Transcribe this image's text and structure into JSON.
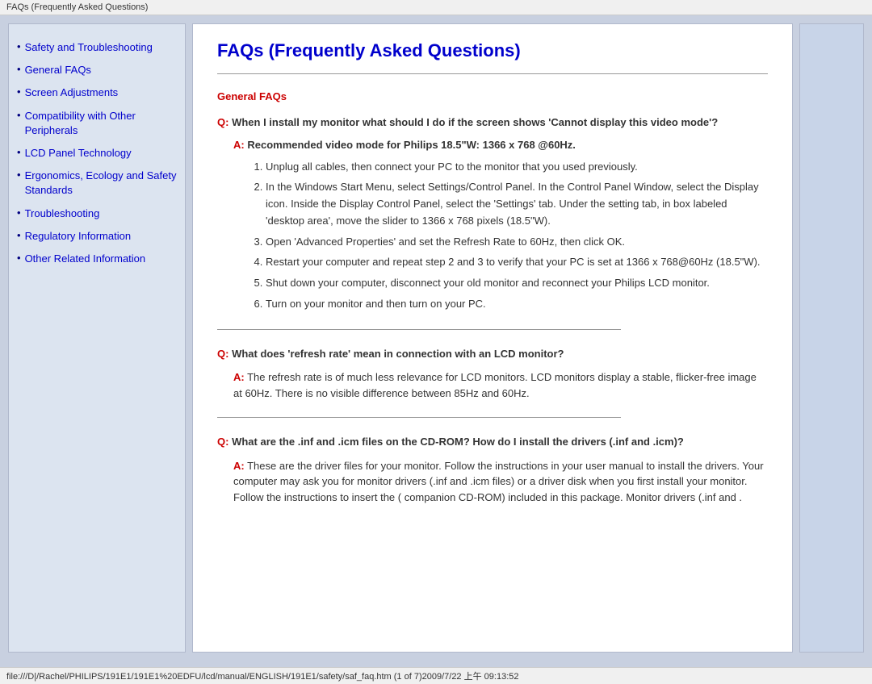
{
  "titleBar": {
    "text": "FAQs (Frequently Asked Questions)"
  },
  "sidebar": {
    "items": [
      {
        "label": "Safety and Troubleshooting",
        "href": "#"
      },
      {
        "label": "General FAQs",
        "href": "#"
      },
      {
        "label": "Screen Adjustments",
        "href": "#"
      },
      {
        "label": "Compatibility with Other Peripherals",
        "href": "#"
      },
      {
        "label": "LCD Panel Technology",
        "href": "#"
      },
      {
        "label": "Ergonomics, Ecology and Safety Standards",
        "href": "#"
      },
      {
        "label": "Troubleshooting",
        "href": "#"
      },
      {
        "label": "Regulatory Information",
        "href": "#"
      },
      {
        "label": "Other Related Information",
        "href": "#"
      }
    ]
  },
  "content": {
    "title": "FAQs (Frequently Asked Questions)",
    "sectionTitle": "General FAQs",
    "q1": {
      "label": "Q:",
      "text": "When I install my monitor what should I do if the screen shows 'Cannot display this video mode'?"
    },
    "a1_recommended": {
      "label": "A:",
      "text": "Recommended video mode for Philips 18.5\"W: 1366 x 768 @60Hz."
    },
    "a1_steps": [
      "Unplug all cables, then connect your PC to the monitor that you used previously.",
      "In the Windows Start Menu, select Settings/Control Panel. In the Control Panel Window, select the Display icon. Inside the Display Control Panel, select the 'Settings' tab. Under the setting tab, in box labeled 'desktop area', move the slider to 1366 x 768 pixels (18.5\"W).",
      "Open 'Advanced Properties' and set the Refresh Rate to 60Hz, then click OK.",
      "Restart your computer and repeat step 2 and 3 to verify that your PC is set at 1366 x 768@60Hz (18.5\"W).",
      "Shut down your computer, disconnect your old monitor and reconnect your Philips LCD monitor.",
      "Turn on your monitor and then turn on your PC."
    ],
    "q2": {
      "label": "Q:",
      "text": "What does 'refresh rate' mean in connection with an LCD monitor?"
    },
    "a2": {
      "label": "A:",
      "text": "The refresh rate is of much less relevance for LCD monitors. LCD monitors display a stable, flicker-free image at 60Hz. There is no visible difference between 85Hz and 60Hz."
    },
    "q3": {
      "label": "Q:",
      "text": "What are the .inf and .icm files on the CD-ROM? How do I install the drivers (.inf and .icm)?"
    },
    "a3": {
      "label": "A:",
      "text": "These are the driver files for your monitor. Follow the instructions in your user manual to install the drivers. Your computer may ask you for monitor drivers (.inf and .icm files) or a driver disk when you first install your monitor. Follow the instructions to insert the ( companion CD-ROM) included in this package. Monitor drivers (.inf and ."
    }
  },
  "statusBar": {
    "text": "file:///D|/Rachel/PHILIPS/191E1/191E1%20EDFU/lcd/manual/ENGLISH/191E1/safety/saf_faq.htm (1 of 7)2009/7/22 上午 09:13:52"
  }
}
